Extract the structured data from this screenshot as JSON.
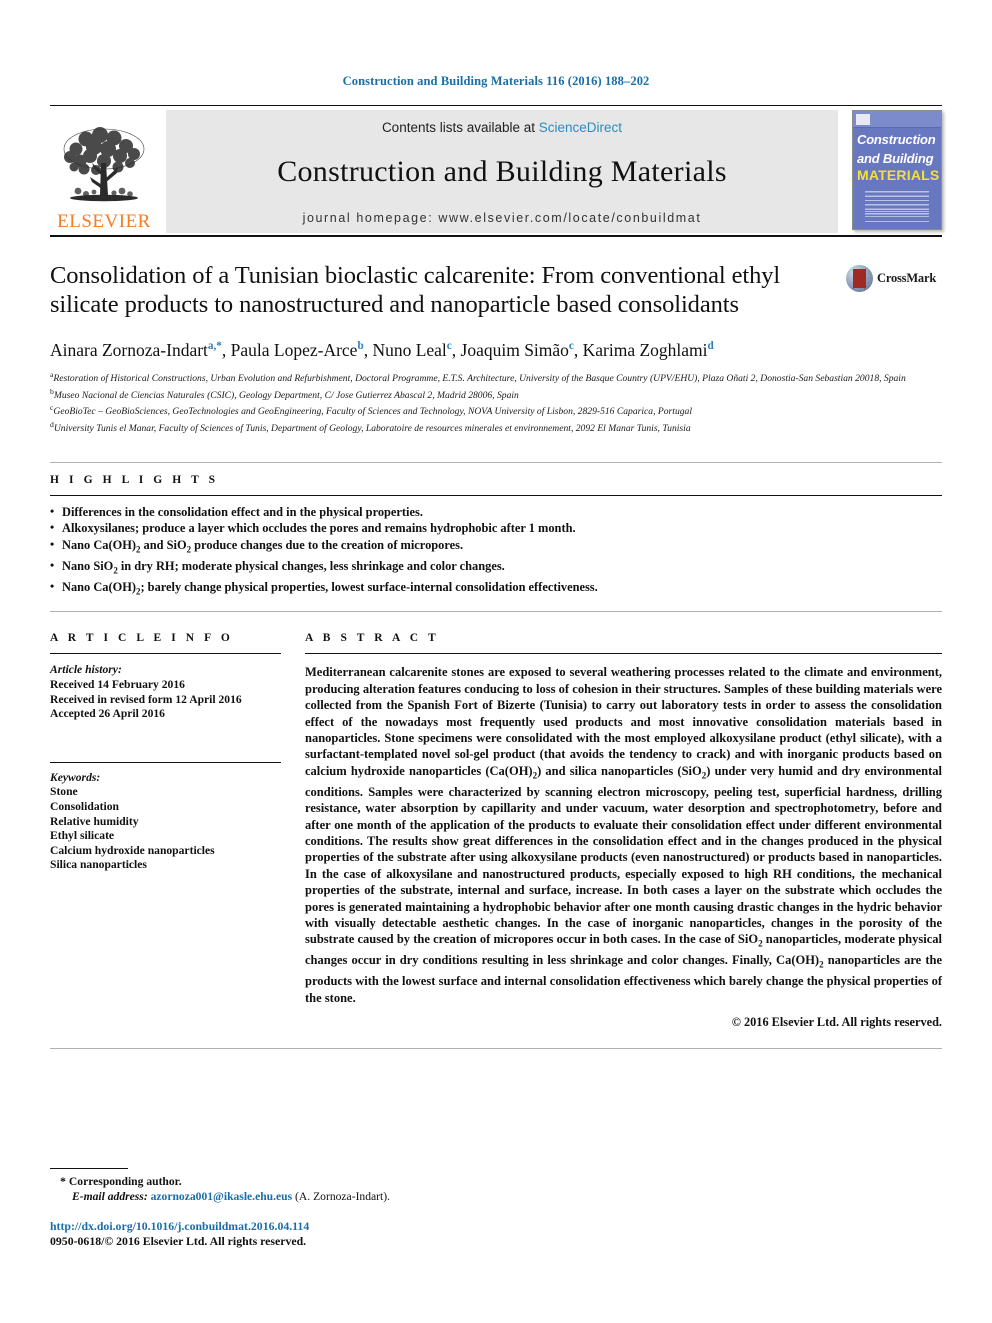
{
  "running_head": "Construction and Building Materials 116 (2016) 188–202",
  "masthead": {
    "elsevier_wordmark": "ELSEVIER",
    "contents_prefix": "Contents lists available at ",
    "contents_link": "ScienceDirect",
    "journal_name": "Construction and Building Materials",
    "homepage": "journal homepage: www.elsevier.com/locate/conbuildmat",
    "cover": {
      "line1": "Construction",
      "line2": "and Building",
      "line3": "MATERIALS"
    }
  },
  "article": {
    "title": "Consolidation of a Tunisian bioclastic calcarenite: From conventional ethyl silicate products to nanostructured and nanoparticle based consolidants",
    "crossmark_label": "CrossMark",
    "authors": [
      {
        "name": "Ainara Zornoza-Indart",
        "marks": "a,*"
      },
      {
        "name": "Paula Lopez-Arce",
        "marks": "b"
      },
      {
        "name": "Nuno Leal",
        "marks": "c"
      },
      {
        "name": "Joaquim Simão",
        "marks": "c"
      },
      {
        "name": "Karima Zoghlami",
        "marks": "d"
      }
    ],
    "affiliations": [
      {
        "mark": "a",
        "text": "Restoration of Historical Constructions, Urban Evolution and Refurbishment, Doctoral Programme, E.T.S. Architecture, University of the Basque Country (UPV/EHU), Plaza Oñati 2, Donostia-San Sebastian 20018, Spain"
      },
      {
        "mark": "b",
        "text": "Museo Nacional de Ciencias Naturales (CSIC), Geology Department, C/ Jose Gutierrez Abascal 2, Madrid 28006, Spain"
      },
      {
        "mark": "c",
        "text": "GeoBioTec – GeoBioSciences, GeoTechnologies and GeoEngineering, Faculty of Sciences and Technology, NOVA University of Lisbon, 2829-516 Caparica, Portugal"
      },
      {
        "mark": "d",
        "text": "University Tunis el Manar, Faculty of Sciences of Tunis, Department of Geology, Laboratoire de resources minerales et environnement, 2092 El Manar Tunis, Tunisia"
      }
    ]
  },
  "highlights": {
    "heading": "H I G H L I G H T S",
    "items": [
      "Differences in the consolidation effect and in the physical properties.",
      "Alkoxysilanes; produce a layer which occludes the pores and remains hydrophobic after 1 month.",
      "Nano Ca(OH)2 and SiO2 produce changes due to the creation of micropores.",
      "Nano SiO2 in dry RH; moderate physical changes, less shrinkage and color changes.",
      "Nano Ca(OH)2; barely change physical properties, lowest surface-internal consolidation effectiveness."
    ]
  },
  "article_info": {
    "heading": "A R T I C L E    I N F O",
    "history_title": "Article history:",
    "history": [
      "Received 14 February 2016",
      "Received in revised form 12 April 2016",
      "Accepted 26 April 2016"
    ],
    "keywords_title": "Keywords:",
    "keywords": [
      "Stone",
      "Consolidation",
      "Relative humidity",
      "Ethyl silicate",
      "Calcium hydroxide nanoparticles",
      "Silica nanoparticles"
    ]
  },
  "abstract": {
    "heading": "A B S T R A C T",
    "text": "Mediterranean calcarenite stones are exposed to several weathering processes related to the climate and environment, producing alteration features conducing to loss of cohesion in their structures. Samples of these building materials were collected from the Spanish Fort of Bizerte (Tunisia) to carry out laboratory tests in order to assess the consolidation effect of the nowadays most frequently used products and most innovative consolidation materials based in nanoparticles. Stone specimens were consolidated with the most employed alkoxysilane product (ethyl silicate), with a surfactant-templated novel sol-gel product (that avoids the tendency to crack) and with inorganic products based on calcium hydroxide nanoparticles (Ca(OH)2) and silica nanoparticles (SiO2) under very humid and dry environmental conditions. Samples were characterized by scanning electron microscopy, peeling test, superficial hardness, drilling resistance, water absorption by capillarity and under vacuum, water desorption and spectrophotometry, before and after one month of the application of the products to evaluate their consolidation effect under different environmental conditions. The results show great differences in the consolidation effect and in the changes produced in the physical properties of the substrate after using alkoxysilane products (even nanostructured) or products based in nanoparticles. In the case of alkoxysilane and nanostructured products, especially exposed to high RH conditions, the mechanical properties of the substrate, internal and surface, increase. In both cases a layer on the substrate which occludes the pores is generated maintaining a hydrophobic behavior after one month causing drastic changes in the hydric behavior with visually detectable aesthetic changes. In the case of inorganic nanoparticles, changes in the porosity of the substrate caused by the creation of micropores occur in both cases. In the case of SiO2 nanoparticles, moderate physical changes occur in dry conditions resulting in less shrinkage and color changes. Finally, Ca(OH)2 nanoparticles are the products with the lowest surface and internal consolidation effectiveness which barely change the physical properties of the stone.",
    "copyright": "© 2016 Elsevier Ltd. All rights reserved."
  },
  "footer": {
    "corresponding_star": "*",
    "corresponding_label": "Corresponding author.",
    "email_label": "E-mail address:",
    "email_address": "azornoza001@ikasle.ehu.eus",
    "email_owner": "(A. Zornoza-Indart).",
    "doi": "http://dx.doi.org/10.1016/j.conbuildmat.2016.04.114",
    "issn": "0950-0618/© 2016 Elsevier Ltd. All rights reserved."
  },
  "colors": {
    "link_blue": "#1a6ea8",
    "sciencedirect_blue": "#2b8cbe",
    "elsevier_orange": "#F57C20",
    "cover_blue": "#6878c0",
    "cover_yellow": "#f3e03a",
    "crossmark_red": "#9e2a23"
  }
}
